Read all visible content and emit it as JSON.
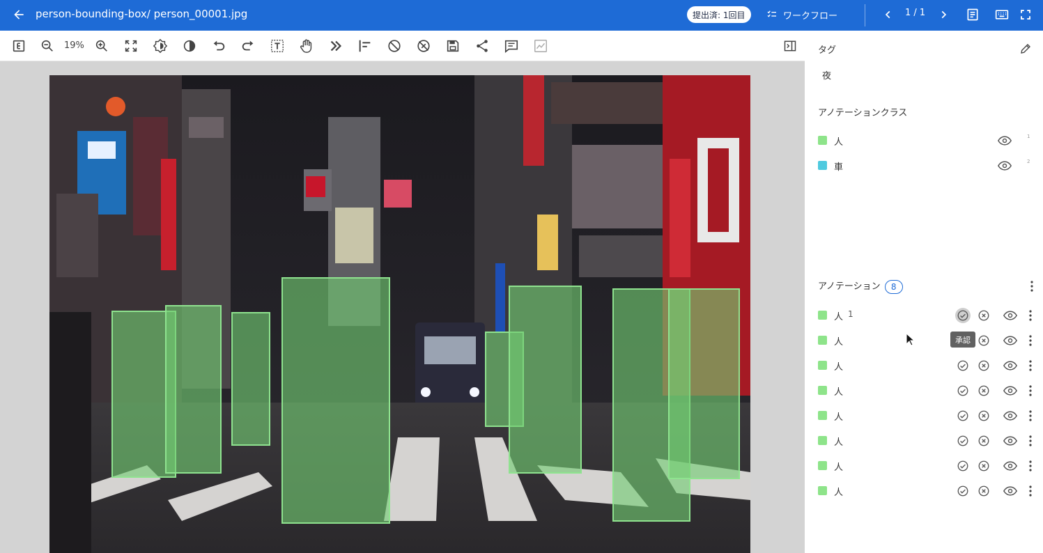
{
  "appbar": {
    "title": "person-bounding-box/ person_00001.jpg",
    "submit_badge": "提出済: 1回目",
    "workflow_label": "ワークフロー",
    "pager": "1 / 1"
  },
  "toolbar": {
    "zoom": "19%"
  },
  "panel": {
    "tags_title": "タグ",
    "tag_value": "夜",
    "classes_title": "アノテーションクラス",
    "classes": [
      {
        "label": "人",
        "color": "#8ee48a",
        "hotkey": "1"
      },
      {
        "label": "車",
        "color": "#4fcadf",
        "hotkey": "2"
      }
    ],
    "annotations_title": "アノテーション",
    "annotations_count": "8",
    "annotations": [
      {
        "label": "人",
        "number": "1"
      },
      {
        "label": "人",
        "number": ""
      },
      {
        "label": "人",
        "number": ""
      },
      {
        "label": "人",
        "number": ""
      },
      {
        "label": "人",
        "number": ""
      },
      {
        "label": "人",
        "number": ""
      },
      {
        "label": "人",
        "number": ""
      },
      {
        "label": "人",
        "number": ""
      }
    ],
    "approve_tooltip": "承認"
  },
  "colors": {
    "appbar": "#1e6bd6",
    "person_class": "#8ee48a",
    "car_class": "#4fcadf"
  }
}
